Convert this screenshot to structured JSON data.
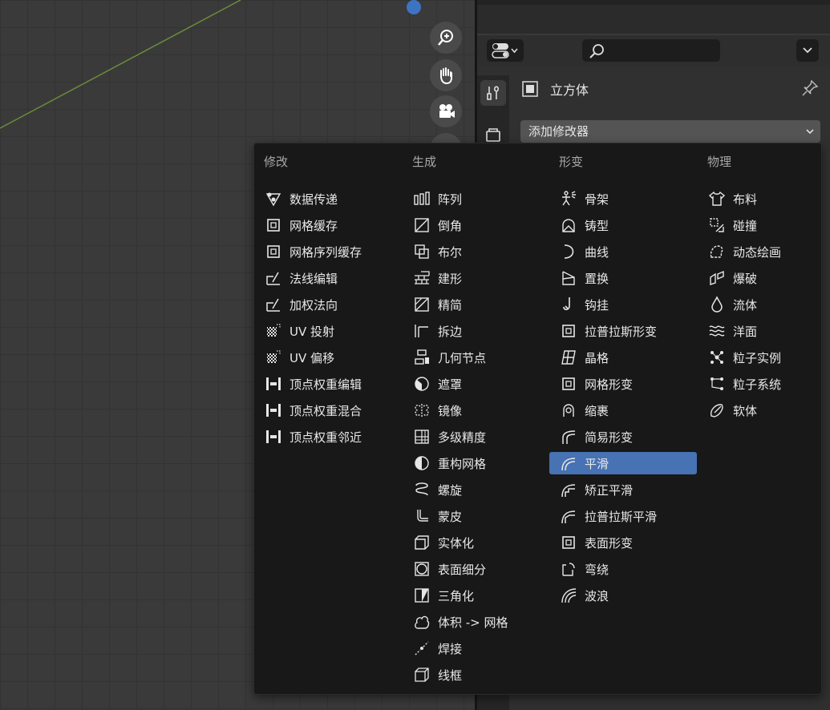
{
  "properties": {
    "object_name": "立方体",
    "add_modifier_label": "添加修改器",
    "search_placeholder": ""
  },
  "menu": {
    "columns": [
      {
        "heading": "修改",
        "items": [
          {
            "label": "数据传递",
            "icon": "data-transfer-icon"
          },
          {
            "label": "网格缓存",
            "icon": "mesh-cache-icon"
          },
          {
            "label": "网格序列缓存",
            "icon": "mesh-sequence-cache-icon"
          },
          {
            "label": "法线编辑",
            "icon": "normal-edit-icon"
          },
          {
            "label": "加权法向",
            "icon": "weighted-normal-icon"
          },
          {
            "label": "UV 投射",
            "icon": "uv-project-icon"
          },
          {
            "label": "UV 偏移",
            "icon": "uv-warp-icon"
          },
          {
            "label": "顶点权重编辑",
            "icon": "vertex-weight-edit-icon"
          },
          {
            "label": "顶点权重混合",
            "icon": "vertex-weight-mix-icon"
          },
          {
            "label": "顶点权重邻近",
            "icon": "vertex-weight-proximity-icon"
          }
        ]
      },
      {
        "heading": "生成",
        "items": [
          {
            "label": "阵列",
            "icon": "array-icon"
          },
          {
            "label": "倒角",
            "icon": "bevel-icon"
          },
          {
            "label": "布尔",
            "icon": "boolean-icon"
          },
          {
            "label": "建形",
            "icon": "build-icon"
          },
          {
            "label": "精简",
            "icon": "decimate-icon"
          },
          {
            "label": "拆边",
            "icon": "edge-split-icon"
          },
          {
            "label": "几何节点",
            "icon": "geometry-nodes-icon"
          },
          {
            "label": "遮罩",
            "icon": "mask-icon"
          },
          {
            "label": "镜像",
            "icon": "mirror-icon"
          },
          {
            "label": "多级精度",
            "icon": "multires-icon"
          },
          {
            "label": "重构网格",
            "icon": "remesh-icon"
          },
          {
            "label": "螺旋",
            "icon": "screw-icon"
          },
          {
            "label": "蒙皮",
            "icon": "skin-icon"
          },
          {
            "label": "实体化",
            "icon": "solidify-icon"
          },
          {
            "label": "表面细分",
            "icon": "subdivision-icon"
          },
          {
            "label": "三角化",
            "icon": "triangulate-icon"
          },
          {
            "label": "体积 -> 网格",
            "icon": "volume-to-mesh-icon"
          },
          {
            "label": "焊接",
            "icon": "weld-icon"
          },
          {
            "label": "线框",
            "icon": "wireframe-icon"
          }
        ]
      },
      {
        "heading": "形变",
        "items": [
          {
            "label": "骨架",
            "icon": "armature-icon"
          },
          {
            "label": "铸型",
            "icon": "cast-icon"
          },
          {
            "label": "曲线",
            "icon": "curve-icon"
          },
          {
            "label": "置换",
            "icon": "displace-icon"
          },
          {
            "label": "钩挂",
            "icon": "hook-icon"
          },
          {
            "label": "拉普拉斯形变",
            "icon": "laplacian-deform-icon"
          },
          {
            "label": "晶格",
            "icon": "lattice-icon"
          },
          {
            "label": "网格形变",
            "icon": "mesh-deform-icon"
          },
          {
            "label": "缩裹",
            "icon": "shrinkwrap-icon"
          },
          {
            "label": "简易形变",
            "icon": "simple-deform-icon"
          },
          {
            "label": "平滑",
            "icon": "smooth-icon",
            "selected": true
          },
          {
            "label": "矫正平滑",
            "icon": "corrective-smooth-icon"
          },
          {
            "label": "拉普拉斯平滑",
            "icon": "laplacian-smooth-icon"
          },
          {
            "label": "表面形变",
            "icon": "surface-deform-icon"
          },
          {
            "label": "弯绕",
            "icon": "warp-icon"
          },
          {
            "label": "波浪",
            "icon": "wave-icon"
          }
        ]
      },
      {
        "heading": "物理",
        "items": [
          {
            "label": "布料",
            "icon": "cloth-icon"
          },
          {
            "label": "碰撞",
            "icon": "collision-icon"
          },
          {
            "label": "动态绘画",
            "icon": "dynamic-paint-icon"
          },
          {
            "label": "爆破",
            "icon": "explode-icon"
          },
          {
            "label": "流体",
            "icon": "fluid-icon"
          },
          {
            "label": "洋面",
            "icon": "ocean-icon"
          },
          {
            "label": "粒子实例",
            "icon": "particle-instance-icon"
          },
          {
            "label": "粒子系统",
            "icon": "particle-system-icon"
          },
          {
            "label": "软体",
            "icon": "soft-body-icon"
          }
        ]
      }
    ]
  },
  "colors": {
    "accent": "#4772b3",
    "menu_bg": "#181818",
    "panel_bg": "#303030"
  }
}
